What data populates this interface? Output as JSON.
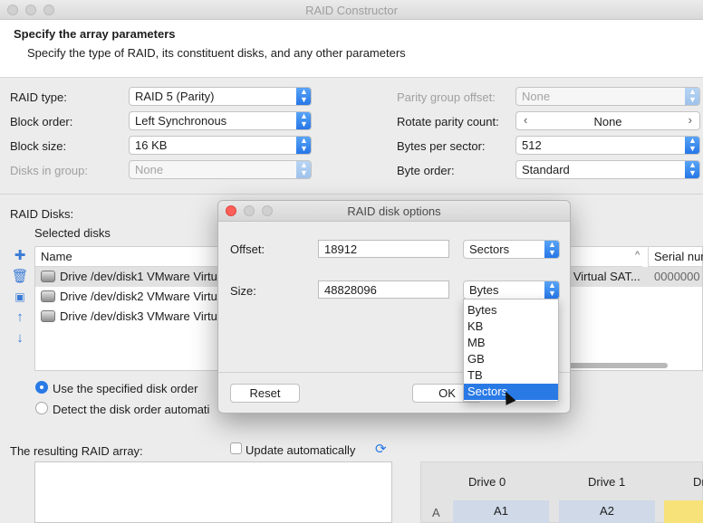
{
  "window": {
    "title": "RAID Constructor"
  },
  "header": {
    "title": "Specify the array parameters",
    "subtitle": "Specify the type of RAID, its constituent disks, and any other parameters"
  },
  "params": {
    "raid_type": {
      "label": "RAID type:",
      "value": "RAID 5 (Parity)"
    },
    "block_order": {
      "label": "Block order:",
      "value": "Left Synchronous"
    },
    "block_size": {
      "label": "Block size:",
      "value": "16 KB"
    },
    "disks_in_group": {
      "label": "Disks in group:",
      "value": "None"
    },
    "parity_group_offset": {
      "label": "Parity group offset:",
      "value": "None"
    },
    "rotate_parity_count": {
      "label": "Rotate parity count:",
      "value": "None"
    },
    "bytes_per_sector": {
      "label": "Bytes per sector:",
      "value": "512"
    },
    "byte_order": {
      "label": "Byte order:",
      "value": "Standard"
    }
  },
  "disks": {
    "label": "RAID Disks:",
    "selected_label": "Selected disks",
    "columns": {
      "name": "Name",
      "serial": "Serial nur"
    },
    "rows": [
      {
        "name": "Drive /dev/disk1 VMware Virtu",
        "model": "e Virtual SAT...",
        "serial": "0000000"
      },
      {
        "name": "Drive /dev/disk2 VMware Virtu",
        "model": "",
        "serial": ""
      },
      {
        "name": "Drive /dev/disk3 VMware Virtu",
        "model": "",
        "serial": ""
      }
    ]
  },
  "order": {
    "use_specified": "Use the specified disk order",
    "detect": "Detect the disk order automati"
  },
  "result": {
    "label": "The resulting RAID array:",
    "update_auto": "Update automatically"
  },
  "grid": {
    "drive_headers": [
      "Drive 0",
      "Drive 1",
      "Dr"
    ],
    "row_label": "A",
    "cells": [
      "A1",
      "A2"
    ]
  },
  "dialog": {
    "title": "RAID disk options",
    "offset_label": "Offset:",
    "offset_value": "18912",
    "offset_unit": "Sectors",
    "size_label": "Size:",
    "size_value": "48828096",
    "size_unit": "Bytes",
    "reset": "Reset",
    "ok": "OK",
    "unit_options": [
      "Bytes",
      "KB",
      "MB",
      "GB",
      "TB",
      "Sectors"
    ]
  },
  "colors": {
    "accent": "#2a7ae6",
    "cell_fill": "#cfd9e8",
    "yellow_cell": "#f7e27a"
  }
}
